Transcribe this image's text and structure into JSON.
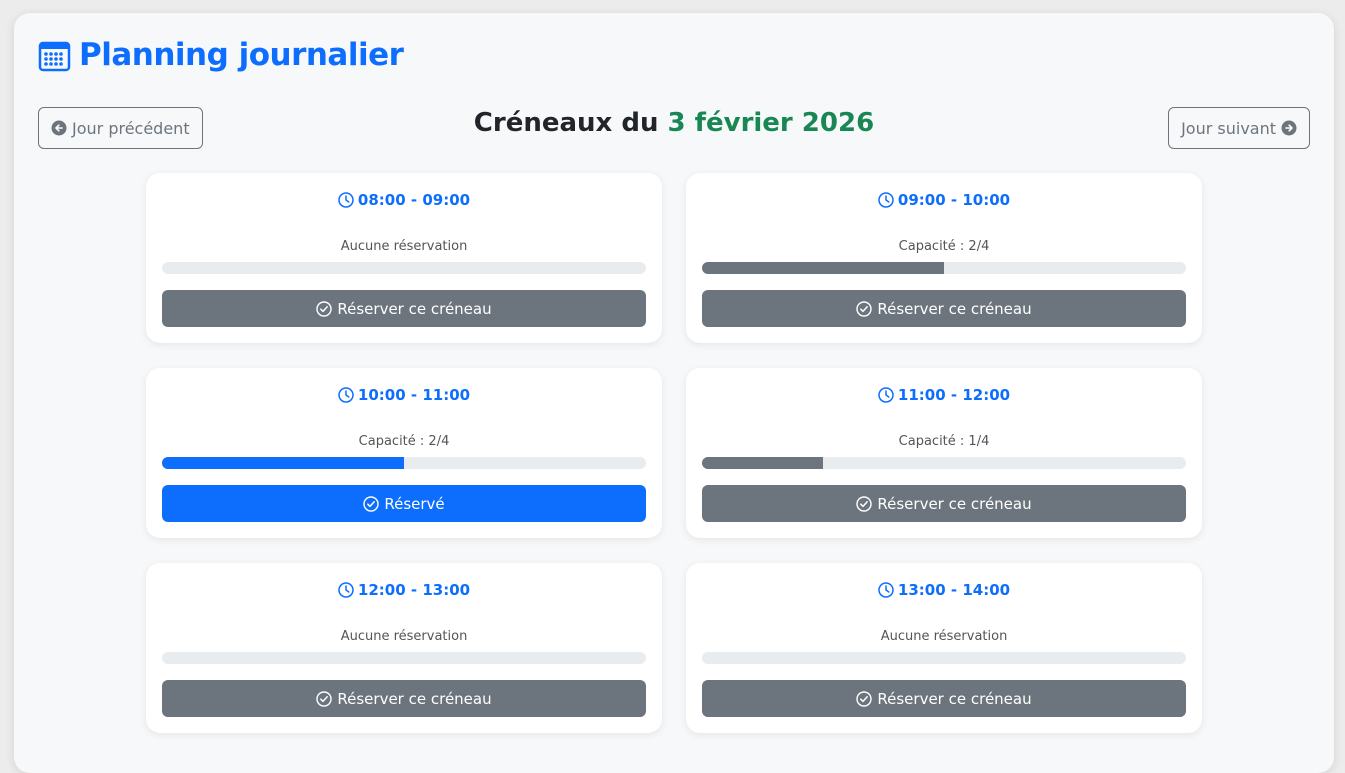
{
  "page": {
    "title": "Planning journalier",
    "title_icon": "calendar-icon",
    "prev_label": "Jour précédent",
    "next_label": "Jour suivant",
    "heading_prefix": "Créneaux du ",
    "heading_date": "3 février 2026"
  },
  "colors": {
    "primary": "#0d6efd",
    "secondary": "#6c757d",
    "success": "#198754"
  },
  "slots": [
    {
      "time": "08:00 - 09:00",
      "status": "Aucune réservation",
      "fill": 0,
      "button": "Réserver ce créneau",
      "reserved": false
    },
    {
      "time": "09:00 - 10:00",
      "status": "Capacité : 2/4",
      "fill": 0.5,
      "button": "Réserver ce créneau",
      "reserved": false
    },
    {
      "time": "10:00 - 11:00",
      "status": "Capacité : 2/4",
      "fill": 0.5,
      "button": "Réservé",
      "reserved": true
    },
    {
      "time": "11:00 - 12:00",
      "status": "Capacité : 1/4",
      "fill": 0.25,
      "button": "Réserver ce créneau",
      "reserved": false
    },
    {
      "time": "12:00 - 13:00",
      "status": "Aucune réservation",
      "fill": 0,
      "button": "Réserver ce créneau",
      "reserved": false
    },
    {
      "time": "13:00 - 14:00",
      "status": "Aucune réservation",
      "fill": 0,
      "button": "Réserver ce créneau",
      "reserved": false
    }
  ]
}
